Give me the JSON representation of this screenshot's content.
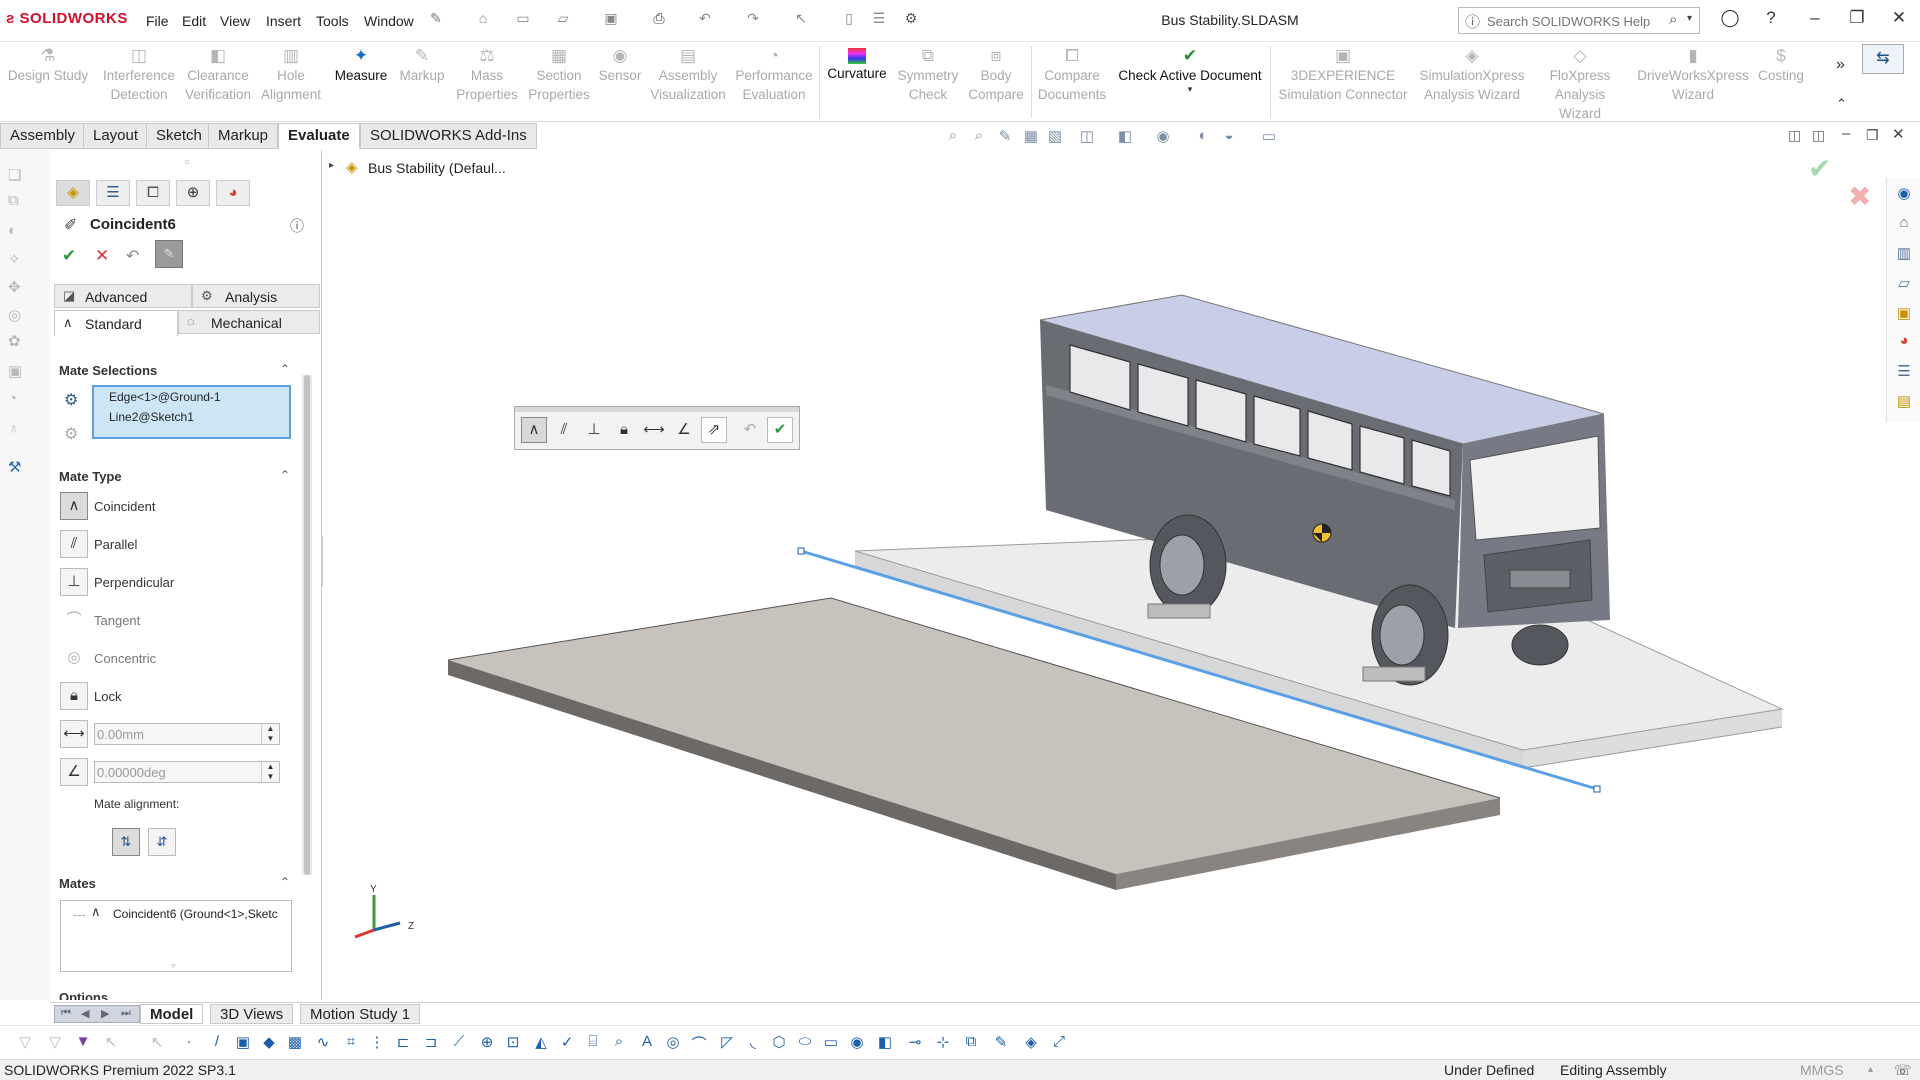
{
  "app": {
    "logo": "SOLIDWORKS",
    "document_title": "Bus Stability.SLDASM"
  },
  "menu": [
    "File",
    "Edit",
    "View",
    "Insert",
    "Tools",
    "Window"
  ],
  "search": {
    "placeholder": "Search SOLIDWORKS Help"
  },
  "ribbon": [
    {
      "label": "Design Study",
      "active": false
    },
    {
      "label": "Interference Detection",
      "active": false
    },
    {
      "label": "Clearance Verification",
      "active": false
    },
    {
      "label": "Hole Alignment",
      "active": false
    },
    {
      "label": "Measure",
      "active": true
    },
    {
      "label": "Markup",
      "active": false
    },
    {
      "label": "Mass Properties",
      "active": false
    },
    {
      "label": "Section Properties",
      "active": false
    },
    {
      "label": "Sensor",
      "active": false
    },
    {
      "label": "Assembly Visualization",
      "active": false
    },
    {
      "label": "Performance Evaluation",
      "active": false
    },
    {
      "label": "Curvature",
      "active": true
    },
    {
      "label": "Symmetry Check",
      "active": false
    },
    {
      "label": "Body Compare",
      "active": false
    },
    {
      "label": "Compare Documents",
      "active": false
    },
    {
      "label": "Check Active Document",
      "active": true
    },
    {
      "label": "3DEXPERIENCE Simulation Connector",
      "active": false
    },
    {
      "label": "SimulationXpress Analysis Wizard",
      "active": false
    },
    {
      "label": "FloXpress Analysis Wizard",
      "active": false
    },
    {
      "label": "DriveWorksXpress Wizard",
      "active": false
    },
    {
      "label": "Costing",
      "active": false
    }
  ],
  "command_tabs": [
    "Assembly",
    "Layout",
    "Sketch",
    "Markup",
    "Evaluate",
    "SOLIDWORKS Add-Ins"
  ],
  "active_command_tab": "Evaluate",
  "property_manager": {
    "title": "Coincident6",
    "tabs": {
      "advanced": "Advanced",
      "analysis": "Analysis",
      "standard": "Standard",
      "mechanical": "Mechanical"
    },
    "mate_selections": {
      "header": "Mate Selections",
      "items": [
        "Edge<1>@Ground-1",
        "Line2@Sketch1"
      ]
    },
    "mate_type": {
      "header": "Mate Type",
      "types": [
        "Coincident",
        "Parallel",
        "Perpendicular",
        "Tangent",
        "Concentric",
        "Lock"
      ],
      "distance": "0.00mm",
      "angle": "0.00000deg",
      "alignment_label": "Mate alignment:"
    },
    "mates": {
      "header": "Mates",
      "items": [
        "Coincident6 (Ground<1>,Sketc"
      ]
    },
    "options_header": "Options"
  },
  "feature_tree": {
    "root": "Bus Stability  (Defaul..."
  },
  "triad": {
    "y": "Y",
    "z": "Z"
  },
  "bottom_tabs": [
    "Model",
    "3D Views",
    "Motion Study 1"
  ],
  "active_bottom_tab": "Model",
  "status": {
    "left": "SOLIDWORKS Premium 2022 SP3.1",
    "defined": "Under Defined",
    "mode": "Editing Assembly",
    "units": "MMGS"
  },
  "colors": {
    "accent": "#1c6fb8",
    "selection": "#cde6f7",
    "bus_body": "#6a6c74",
    "bus_roof": "#c9cee8",
    "platform": "#e9e9e9",
    "ground": "#c8c2bd",
    "line": "#5aa0e6"
  }
}
